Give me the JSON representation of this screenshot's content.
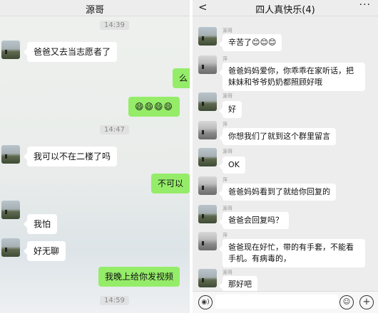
{
  "left_chat": {
    "title": "源哥",
    "times": [
      "14:39",
      "14:47",
      "14:59"
    ],
    "messages": [
      "爸爸又去当志愿者了",
      "么",
      "😄😄😄😄",
      "我可以不在二楼了吗",
      "不可以",
      "我怕",
      "好无聊",
      "我晚上给你发视频"
    ]
  },
  "right_chat": {
    "title": "四人真快乐(4)",
    "back_glyph": "<",
    "more_glyph": "···",
    "senders": [
      "源哥",
      "萍",
      "源哥",
      "萍",
      "源哥",
      "萍",
      "源哥",
      "萍",
      "源哥"
    ],
    "messages": [
      "辛苦了😊😊😊",
      "爸爸妈妈爱你，你乖乖在家听话，把妹妹和爷爷奶奶都照顾好哦",
      "好",
      "你想我们了就到这个群里留言",
      "OK",
      "爸爸妈妈看到了就给你回复的",
      "爸爸会回复吗？",
      "爸爸现在好忙，带的有手套，不能看手机。有病毒的，",
      "那好吧"
    ],
    "footer": {
      "voice_glyph": "◉)",
      "emoji_glyph": "☺",
      "plus_glyph": "+"
    }
  },
  "colors": {
    "bubble_green": "#95ec69",
    "bubble_white": "#ffffff",
    "background": "#ededed"
  }
}
